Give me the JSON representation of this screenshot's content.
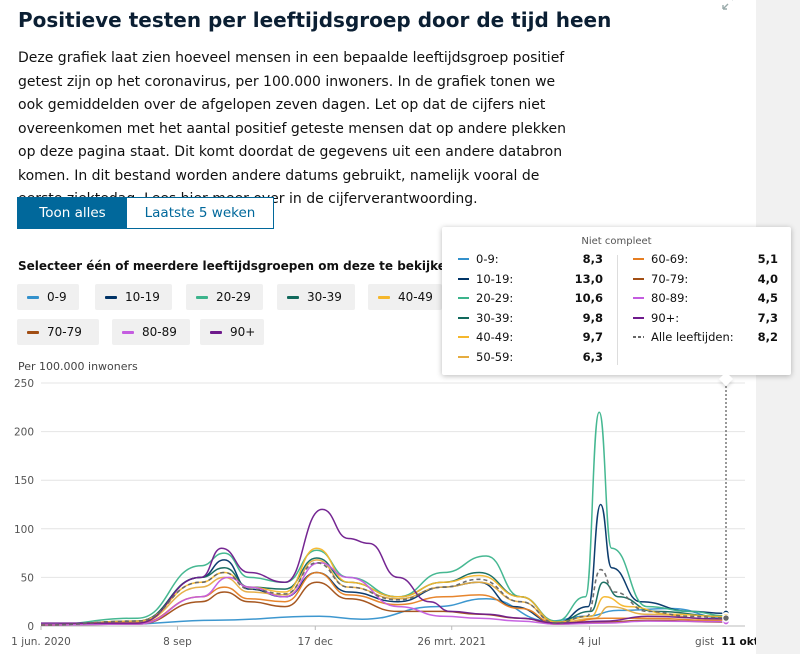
{
  "title": "Positieve testen per leeftijdsgroep door de tijd heen",
  "description": "Deze grafiek laat zien hoeveel mensen in een bepaalde leeftijdsgroep positief getest zijn op het coronavirus, per 100.000 inwoners. In de grafiek tonen we ook gemiddelden over de afgelopen zeven dagen. Let op dat de cijfers niet overeenkomen met het aantal positief geteste mensen dat op andere plekken op deze pagina staat. Dit komt doordat de gegevens uit een andere databron komen. In dit bestand worden andere datums gebruikt, namelijk vooral de eerste ziektedag. Lees hier meer over in de cijferverantwoording.",
  "toggle": {
    "all": "Toon alles",
    "last5": "Laatste 5 weken"
  },
  "select_title": "Selecteer één of meerdere leeftijdsgroepen om deze te bekijken",
  "chips": [
    {
      "label": "0-9",
      "color": "#3391cc"
    },
    {
      "label": "10-19",
      "color": "#003366"
    },
    {
      "label": "20-29",
      "color": "#3cb48c"
    },
    {
      "label": "30-39",
      "color": "#11695c"
    },
    {
      "label": "40-49",
      "color": "#f5b72c"
    },
    {
      "label": "50-59",
      "color": "#e5ac40"
    },
    {
      "label": "60-69",
      "color": "#e67e22"
    },
    {
      "label": "70-79",
      "color": "#a14e14"
    },
    {
      "label": "80-89",
      "color": "#c45ce0"
    },
    {
      "label": "90+",
      "color": "#6e1a8c"
    }
  ],
  "tooltip": {
    "header": "Niet compleet",
    "rows": [
      {
        "label": "0-9:",
        "value": "8,3",
        "color": "#3391cc"
      },
      {
        "label": "10-19:",
        "value": "13,0",
        "color": "#003366"
      },
      {
        "label": "20-29:",
        "value": "10,6",
        "color": "#3cb48c"
      },
      {
        "label": "30-39:",
        "value": "9,8",
        "color": "#11695c"
      },
      {
        "label": "40-49:",
        "value": "9,7",
        "color": "#f5b72c"
      },
      {
        "label": "50-59:",
        "value": "6,3",
        "color": "#e5ac40"
      },
      {
        "label": "60-69:",
        "value": "5,1",
        "color": "#e67e22"
      },
      {
        "label": "70-79:",
        "value": "4,0",
        "color": "#a14e14"
      },
      {
        "label": "80-89:",
        "value": "4,5",
        "color": "#c45ce0"
      },
      {
        "label": "90+:",
        "value": "7,3",
        "color": "#6e1a8c"
      },
      {
        "label": "Alle leeftijden:",
        "value": "8,2",
        "color": "#666666",
        "dashed": true
      }
    ]
  },
  "chart_data": {
    "type": "line",
    "ylabel": "Per 100.000 inwoners",
    "ylim": [
      0,
      250
    ],
    "y_ticks": [
      0,
      50,
      100,
      150,
      200,
      250
    ],
    "x_ticks": [
      {
        "label": "1 jun. 2020",
        "date": "2020-06-01"
      },
      {
        "label": "8 sep",
        "date": "2020-09-08"
      },
      {
        "label": "17 dec",
        "date": "2020-12-17"
      },
      {
        "label": "26 mrt. 2021",
        "date": "2021-03-26"
      },
      {
        "label": "4 jul",
        "date": "2021-07-04"
      },
      {
        "label": "gist",
        "date": "2021-10-10"
      },
      {
        "label": "11 okt",
        "date": "2021-10-11",
        "bold": true
      }
    ],
    "x_range": [
      "2020-06-01",
      "2021-10-11"
    ],
    "grid": true,
    "series": [
      {
        "name": "0-9",
        "color": "#3391cc",
        "points": [
          [
            "2020-06-01",
            1
          ],
          [
            "2020-08-01",
            2
          ],
          [
            "2020-10-05",
            6
          ],
          [
            "2020-12-20",
            10
          ],
          [
            "2021-01-20",
            7
          ],
          [
            "2021-03-15",
            20
          ],
          [
            "2021-04-20",
            28
          ],
          [
            "2021-06-05",
            5
          ],
          [
            "2021-07-01",
            10
          ],
          [
            "2021-07-25",
            16
          ],
          [
            "2021-09-01",
            18
          ],
          [
            "2021-10-10",
            8
          ]
        ]
      },
      {
        "name": "10-19",
        "color": "#003366",
        "points": [
          [
            "2020-06-01",
            1
          ],
          [
            "2020-08-10",
            5
          ],
          [
            "2020-09-25",
            50
          ],
          [
            "2020-10-12",
            68
          ],
          [
            "2020-10-30",
            38
          ],
          [
            "2020-11-25",
            30
          ],
          [
            "2020-12-18",
            55
          ],
          [
            "2021-01-10",
            35
          ],
          [
            "2021-02-15",
            25
          ],
          [
            "2021-03-20",
            40
          ],
          [
            "2021-04-15",
            45
          ],
          [
            "2021-05-10",
            20
          ],
          [
            "2021-06-10",
            3
          ],
          [
            "2021-07-03",
            20
          ],
          [
            "2021-07-12",
            125
          ],
          [
            "2021-07-20",
            60
          ],
          [
            "2021-08-10",
            25
          ],
          [
            "2021-09-15",
            15
          ],
          [
            "2021-10-10",
            13
          ]
        ]
      },
      {
        "name": "20-29",
        "color": "#3cb48c",
        "points": [
          [
            "2020-06-01",
            1
          ],
          [
            "2020-08-10",
            8
          ],
          [
            "2020-09-25",
            62
          ],
          [
            "2020-10-12",
            75
          ],
          [
            "2020-10-30",
            50
          ],
          [
            "2020-11-25",
            45
          ],
          [
            "2020-12-18",
            78
          ],
          [
            "2021-01-10",
            50
          ],
          [
            "2021-02-15",
            30
          ],
          [
            "2021-03-20",
            55
          ],
          [
            "2021-04-20",
            72
          ],
          [
            "2021-05-15",
            30
          ],
          [
            "2021-06-10",
            5
          ],
          [
            "2021-07-01",
            30
          ],
          [
            "2021-07-11",
            220
          ],
          [
            "2021-07-20",
            80
          ],
          [
            "2021-08-15",
            20
          ],
          [
            "2021-09-15",
            15
          ],
          [
            "2021-10-10",
            10.6
          ]
        ]
      },
      {
        "name": "30-39",
        "color": "#11695c",
        "points": [
          [
            "2020-06-01",
            1
          ],
          [
            "2020-08-10",
            5
          ],
          [
            "2020-09-25",
            50
          ],
          [
            "2020-10-12",
            60
          ],
          [
            "2020-10-30",
            40
          ],
          [
            "2020-11-25",
            38
          ],
          [
            "2020-12-18",
            70
          ],
          [
            "2021-01-10",
            45
          ],
          [
            "2021-02-15",
            30
          ],
          [
            "2021-03-20",
            45
          ],
          [
            "2021-04-15",
            55
          ],
          [
            "2021-05-15",
            30
          ],
          [
            "2021-06-10",
            4
          ],
          [
            "2021-07-05",
            15
          ],
          [
            "2021-07-14",
            45
          ],
          [
            "2021-07-25",
            30
          ],
          [
            "2021-08-20",
            15
          ],
          [
            "2021-10-10",
            9.8
          ]
        ]
      },
      {
        "name": "40-49",
        "color": "#f5b72c",
        "points": [
          [
            "2020-06-01",
            1
          ],
          [
            "2020-08-10",
            5
          ],
          [
            "2020-09-25",
            45
          ],
          [
            "2020-10-12",
            55
          ],
          [
            "2020-10-30",
            40
          ],
          [
            "2020-11-25",
            35
          ],
          [
            "2020-12-18",
            80
          ],
          [
            "2021-01-10",
            45
          ],
          [
            "2021-02-15",
            30
          ],
          [
            "2021-03-20",
            45
          ],
          [
            "2021-04-15",
            52
          ],
          [
            "2021-05-15",
            30
          ],
          [
            "2021-06-10",
            4
          ],
          [
            "2021-07-05",
            10
          ],
          [
            "2021-07-15",
            30
          ],
          [
            "2021-08-01",
            20
          ],
          [
            "2021-09-01",
            12
          ],
          [
            "2021-10-10",
            9.7
          ]
        ]
      },
      {
        "name": "50-59",
        "color": "#e5ac40",
        "points": [
          [
            "2020-06-01",
            1
          ],
          [
            "2020-08-10",
            4
          ],
          [
            "2020-09-25",
            40
          ],
          [
            "2020-10-12",
            50
          ],
          [
            "2020-10-30",
            35
          ],
          [
            "2020-11-25",
            32
          ],
          [
            "2020-12-18",
            68
          ],
          [
            "2021-01-10",
            40
          ],
          [
            "2021-02-15",
            28
          ],
          [
            "2021-03-20",
            40
          ],
          [
            "2021-04-15",
            45
          ],
          [
            "2021-05-15",
            25
          ],
          [
            "2021-06-10",
            3
          ],
          [
            "2021-07-08",
            8
          ],
          [
            "2021-07-18",
            20
          ],
          [
            "2021-08-15",
            12
          ],
          [
            "2021-10-10",
            6.3
          ]
        ]
      },
      {
        "name": "60-69",
        "color": "#e67e22",
        "points": [
          [
            "2020-06-01",
            1
          ],
          [
            "2020-08-10",
            3
          ],
          [
            "2020-09-25",
            30
          ],
          [
            "2020-10-12",
            40
          ],
          [
            "2020-10-30",
            28
          ],
          [
            "2020-11-25",
            25
          ],
          [
            "2020-12-18",
            55
          ],
          [
            "2021-01-10",
            32
          ],
          [
            "2021-02-15",
            22
          ],
          [
            "2021-03-20",
            30
          ],
          [
            "2021-04-15",
            32
          ],
          [
            "2021-05-15",
            18
          ],
          [
            "2021-06-10",
            2
          ],
          [
            "2021-07-15",
            8
          ],
          [
            "2021-08-15",
            8
          ],
          [
            "2021-10-10",
            5.1
          ]
        ]
      },
      {
        "name": "70-79",
        "color": "#a14e14",
        "points": [
          [
            "2020-06-01",
            1
          ],
          [
            "2020-08-10",
            2
          ],
          [
            "2020-09-25",
            25
          ],
          [
            "2020-10-12",
            35
          ],
          [
            "2020-10-30",
            25
          ],
          [
            "2020-11-25",
            20
          ],
          [
            "2020-12-18",
            45
          ],
          [
            "2021-01-10",
            28
          ],
          [
            "2021-02-15",
            15
          ],
          [
            "2021-03-20",
            15
          ],
          [
            "2021-04-15",
            12
          ],
          [
            "2021-05-15",
            8
          ],
          [
            "2021-06-10",
            2
          ],
          [
            "2021-07-15",
            4
          ],
          [
            "2021-08-15",
            6
          ],
          [
            "2021-10-10",
            4.0
          ]
        ]
      },
      {
        "name": "80-89",
        "color": "#c45ce0",
        "points": [
          [
            "2020-06-01",
            1
          ],
          [
            "2020-08-10",
            2
          ],
          [
            "2020-09-25",
            30
          ],
          [
            "2020-10-15",
            50
          ],
          [
            "2020-10-30",
            40
          ],
          [
            "2020-11-25",
            30
          ],
          [
            "2020-12-20",
            65
          ],
          [
            "2021-01-10",
            50
          ],
          [
            "2021-02-15",
            20
          ],
          [
            "2021-03-20",
            10
          ],
          [
            "2021-04-15",
            8
          ],
          [
            "2021-05-15",
            5
          ],
          [
            "2021-06-10",
            2
          ],
          [
            "2021-07-15",
            3
          ],
          [
            "2021-08-15",
            5
          ],
          [
            "2021-10-10",
            4.5
          ]
        ]
      },
      {
        "name": "90+",
        "color": "#6e1a8c",
        "points": [
          [
            "2020-06-01",
            3
          ],
          [
            "2020-08-10",
            3
          ],
          [
            "2020-09-25",
            50
          ],
          [
            "2020-10-10",
            80
          ],
          [
            "2020-10-30",
            55
          ],
          [
            "2020-11-25",
            45
          ],
          [
            "2020-12-22",
            120
          ],
          [
            "2021-01-10",
            90
          ],
          [
            "2021-01-25",
            85
          ],
          [
            "2021-02-15",
            50
          ],
          [
            "2021-03-10",
            25
          ],
          [
            "2021-03-25",
            15
          ],
          [
            "2021-04-20",
            12
          ],
          [
            "2021-05-15",
            8
          ],
          [
            "2021-06-10",
            3
          ],
          [
            "2021-07-15",
            5
          ],
          [
            "2021-08-15",
            10
          ],
          [
            "2021-10-10",
            7.3
          ]
        ]
      },
      {
        "name": "Alle leeftijden",
        "color": "#666666",
        "dashed": true,
        "points": [
          [
            "2020-06-01",
            1
          ],
          [
            "2020-08-10",
            5
          ],
          [
            "2020-09-25",
            45
          ],
          [
            "2020-10-12",
            55
          ],
          [
            "2020-10-30",
            38
          ],
          [
            "2020-11-25",
            33
          ],
          [
            "2020-12-18",
            65
          ],
          [
            "2021-01-10",
            40
          ],
          [
            "2021-02-15",
            27
          ],
          [
            "2021-03-20",
            40
          ],
          [
            "2021-04-15",
            48
          ],
          [
            "2021-05-15",
            25
          ],
          [
            "2021-06-10",
            3
          ],
          [
            "2021-07-02",
            10
          ],
          [
            "2021-07-12",
            58
          ],
          [
            "2021-07-22",
            35
          ],
          [
            "2021-08-15",
            15
          ],
          [
            "2021-09-15",
            10
          ],
          [
            "2021-10-10",
            8.2
          ]
        ]
      }
    ]
  }
}
